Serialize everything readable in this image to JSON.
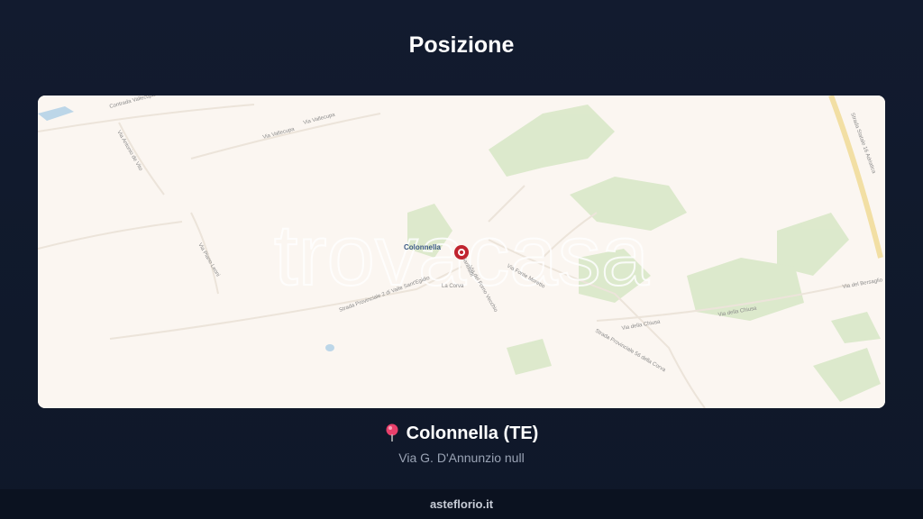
{
  "header": {
    "title": "Posizione"
  },
  "map": {
    "watermark": "trovacasa",
    "place_label": "Colonnella",
    "roads": [
      "Contrada Vallecupa",
      "Via Vallecupa",
      "Via Vallecupa",
      "Via Antonio de Vito",
      "Via Piano Leoni",
      "Strada Provinciale 2 di Valle Sant'Egidio",
      "Via del Forno Vecchio",
      "Via Fonte Moretto",
      "Via della Chiusa",
      "Via della Chiusa",
      "Strada Provinciale 56 della Corva",
      "Via del Bersaglio",
      "Strada Statale 16 Adriatica",
      "Via Garibaldi",
      "La Corva"
    ],
    "marker_color": "#c0242f"
  },
  "location": {
    "name": "Colonnella (TE)",
    "address": "Via G. D'Annunzio null",
    "pin_icon": "map-pin-icon"
  },
  "footer": {
    "brand": "asteflorio.it"
  }
}
